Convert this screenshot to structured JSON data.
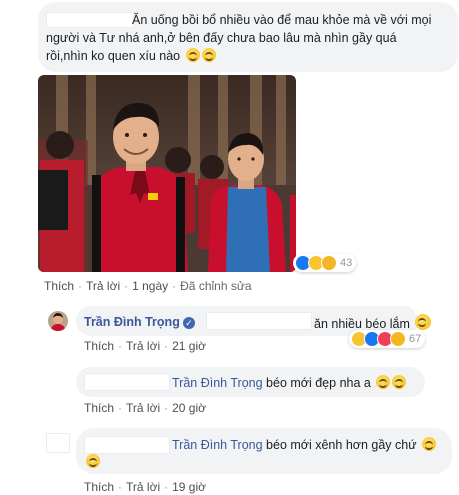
{
  "comment1": {
    "lines": [
      "Ăn uống bồi bổ nhiều vào để mau khỏe mà về với mọi",
      "người và Tư nhá anh,ở bên đấy chưa bao lâu mà nhìn gầy quá",
      "rồi,nhìn ko quen xíu nào"
    ],
    "reaction_count": "43",
    "actions": {
      "like": "Thích",
      "reply": "Trả lời",
      "time": "1 ngày",
      "edited": "Đã chỉnh sửa"
    }
  },
  "comment2": {
    "author": "Trần Đình Trọng",
    "verified": "✓",
    "text": "ăn nhiều béo lắm",
    "reaction_count": "67",
    "actions": {
      "like": "Thích",
      "reply": "Trả lời",
      "time": "21 giờ"
    }
  },
  "comment3": {
    "mention": "Trần Đình Trọng",
    "text": "béo mới đẹp nha a",
    "actions": {
      "like": "Thích",
      "reply": "Trả lời",
      "time": "20 giờ"
    }
  },
  "comment4": {
    "mention": "Trần Đình Trọng",
    "text": "béo mới xênh hơn gầy chứ",
    "actions": {
      "like": "Thích",
      "reply": "Trả lời",
      "time": "19 giờ"
    }
  },
  "icons": {
    "emoji_grin": "grinning-face-icon",
    "emoji_scream": "screaming-face-icon",
    "emoji_tongue": "winking-tongue-face-icon",
    "reaction_like": "like-reaction-icon",
    "reaction_haha": "haha-reaction-icon",
    "reaction_wow": "wow-reaction-icon",
    "reaction_love": "love-reaction-icon"
  },
  "colors": {
    "bubble": "#f2f3f5",
    "link": "#385898",
    "meta": "#606770",
    "jersey": "#c8102e"
  }
}
